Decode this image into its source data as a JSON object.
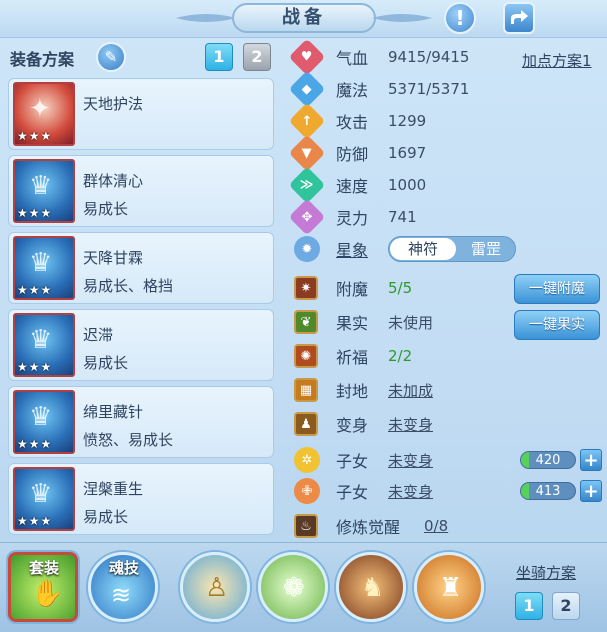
{
  "header": {
    "title": "战备"
  },
  "equipment": {
    "title": "装备方案",
    "plans": [
      "1",
      "2"
    ],
    "cards": [
      {
        "name": "天地护法",
        "trait": "",
        "stars": "★★★"
      },
      {
        "name": "群体清心",
        "trait": "易成长",
        "stars": "★★★"
      },
      {
        "name": "天降甘霖",
        "trait": "易成长、格挡",
        "stars": "★★★"
      },
      {
        "name": "迟滞",
        "trait": "易成长",
        "stars": "★★★"
      },
      {
        "name": "绵里藏针",
        "trait": "愤怒、易成长",
        "stars": "★★★"
      },
      {
        "name": "涅槃重生",
        "trait": "易成长",
        "stars": "★★★"
      }
    ]
  },
  "stats": {
    "plan_link": "加点方案1",
    "rows": [
      {
        "label": "气血",
        "value": "9415/9415",
        "icon": "heart-icon",
        "color": "#e05b6d"
      },
      {
        "label": "魔法",
        "value": "5371/5371",
        "icon": "mana-icon",
        "color": "#4aa6e6"
      },
      {
        "label": "攻击",
        "value": "1299",
        "icon": "attack-icon",
        "color": "#f0a92f"
      },
      {
        "label": "防御",
        "value": "1697",
        "icon": "defense-icon",
        "color": "#e9864a"
      },
      {
        "label": "速度",
        "value": "1000",
        "icon": "speed-icon",
        "color": "#2fc49b"
      },
      {
        "label": "灵力",
        "value": "741",
        "icon": "spirit-icon",
        "color": "#c57ad6"
      }
    ],
    "constellation": {
      "label": "星象",
      "toggle_on": "神符",
      "toggle_off": "雷罡"
    }
  },
  "extras": {
    "rows": [
      {
        "label": "附魔",
        "value": "5/5",
        "green": true,
        "underline": false
      },
      {
        "label": "果实",
        "value": "未使用",
        "green": false,
        "underline": false
      },
      {
        "label": "祈福",
        "value": "2/2",
        "green": true,
        "underline": false
      },
      {
        "label": "封地",
        "value": "未加成",
        "green": false,
        "underline": true
      },
      {
        "label": "变身",
        "value": "未变身",
        "green": false,
        "underline": true
      },
      {
        "label": "子女",
        "value": "未变身",
        "green": false,
        "underline": true
      },
      {
        "label": "子女",
        "value": "未变身",
        "green": false,
        "underline": true
      },
      {
        "label": "修炼觉醒",
        "value": "0/8",
        "green": false,
        "underline": true
      }
    ],
    "btn_enchant": "一键附魔",
    "btn_fruit": "一键果实",
    "child_points": [
      "420",
      "413"
    ]
  },
  "bottom": {
    "skill_labels": [
      "套装",
      "魂技"
    ],
    "mount_title": "坐骑方案",
    "mount_plans": [
      "1",
      "2"
    ]
  }
}
